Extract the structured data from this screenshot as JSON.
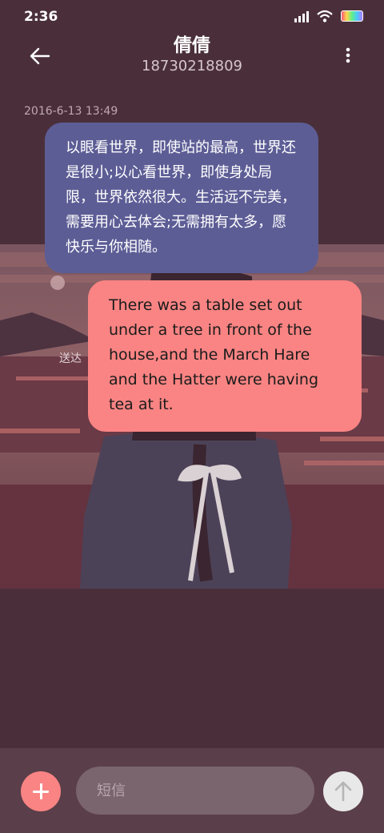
{
  "status_bar": {
    "time": "2:36",
    "icons": [
      "signal-icon",
      "wifi-icon",
      "battery-icon"
    ]
  },
  "header": {
    "contact_name": "倩倩",
    "contact_number": "18730218809",
    "back_icon": "back-arrow-icon",
    "more_icon": "more-vertical-icon"
  },
  "conversation": {
    "timestamp": "2016-6-13 13:49",
    "incoming_message": "以眼看世界，即使站的最高，世界还是很小;以心看世界，即使身处局限，世界依然很大。生活远不完美，需要用心去体会;无需拥有太多，愿快乐与你相随。",
    "outgoing_message": "There was a table set out under a tree in front of the house,and the March Hare and the Hatter were having tea at it.",
    "delivered_label": "送达"
  },
  "composer": {
    "add_icon": "plus-icon",
    "input_placeholder": "短信",
    "send_icon": "send-arrow-icon"
  },
  "colors": {
    "background": "#4a2f3a",
    "incoming_bubble": "#5d5d96",
    "outgoing_bubble": "#f98483",
    "composer_bar": "#5a3e49"
  }
}
